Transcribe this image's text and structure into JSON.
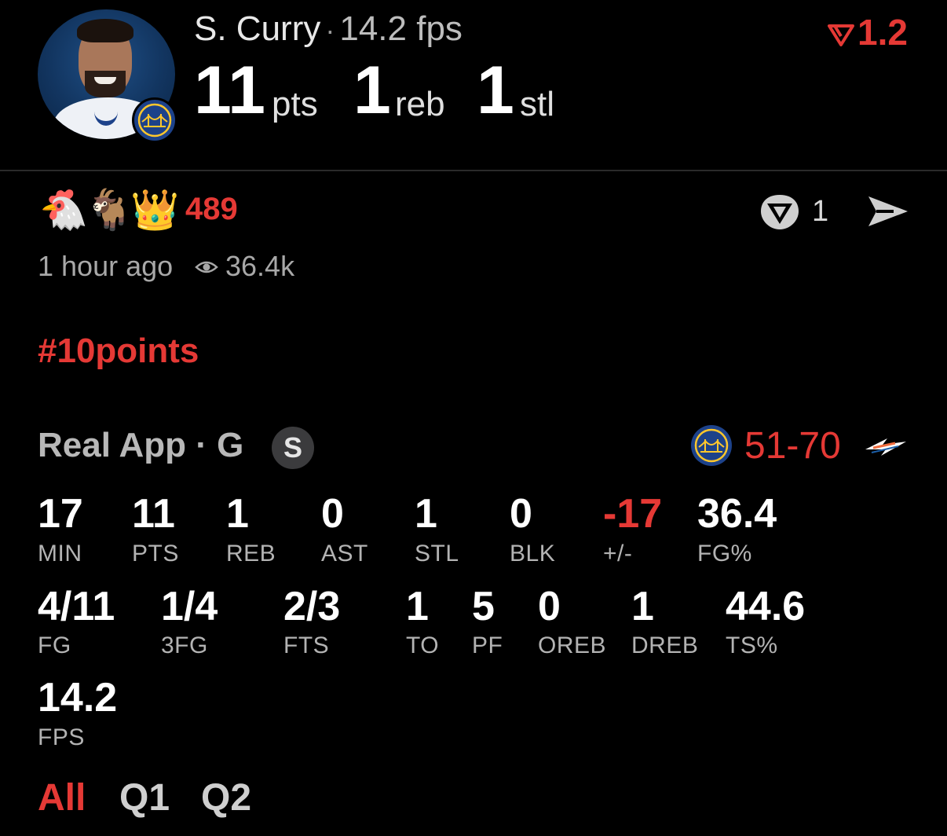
{
  "player": {
    "name": "S. Curry",
    "fps": "14.2 fps",
    "headline_stats": [
      {
        "value": "11",
        "unit": "pts"
      },
      {
        "value": "1",
        "unit": "reb"
      },
      {
        "value": "1",
        "unit": "stl"
      }
    ],
    "avatar_icon": "player-photo",
    "team_badge_icon": "warriors-bridge-logo"
  },
  "score_change": "1.2",
  "reactions": {
    "emojis": [
      "🐔",
      "🐐",
      "👑"
    ],
    "count": "489"
  },
  "actions": {
    "vote_count": "1",
    "vote_icon": "t-shield-icon",
    "share_icon": "send-icon"
  },
  "meta": {
    "time": "1 hour ago",
    "views": "36.4k"
  },
  "hashtag": "#10points",
  "source": {
    "label": "Real App · G",
    "badge": "S"
  },
  "game": {
    "score": "51-70",
    "home_icon": "warriors-logo",
    "away_icon": "thunder-logo"
  },
  "box_score": {
    "row1": [
      {
        "value": "17",
        "label": "MIN"
      },
      {
        "value": "11",
        "label": "PTS"
      },
      {
        "value": "1",
        "label": "REB"
      },
      {
        "value": "0",
        "label": "AST"
      },
      {
        "value": "1",
        "label": "STL"
      },
      {
        "value": "0",
        "label": "BLK"
      },
      {
        "value": "-17",
        "label": "+/-"
      },
      {
        "value": "36.4",
        "label": "FG%"
      }
    ],
    "row2": [
      {
        "value": "4/11",
        "label": "FG"
      },
      {
        "value": "1/4",
        "label": "3FG"
      },
      {
        "value": "2/3",
        "label": "FTS"
      },
      {
        "value": "1",
        "label": "TO"
      },
      {
        "value": "5",
        "label": "PF"
      },
      {
        "value": "0",
        "label": "OREB"
      },
      {
        "value": "1",
        "label": "DREB"
      },
      {
        "value": "44.6",
        "label": "TS%"
      }
    ],
    "row3": [
      {
        "value": "14.2",
        "label": "FPS"
      }
    ]
  },
  "tabs": [
    "All",
    "Q1",
    "Q2"
  ],
  "colors": {
    "accent_red": "#e53935",
    "warriors_blue": "#1d428a",
    "warriors_gold": "#ffc72c"
  }
}
